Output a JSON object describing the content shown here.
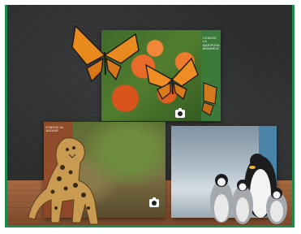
{
  "cards": {
    "top": {
      "side_text": "CONOCE LA\nMARIPOSA MONARCA"
    },
    "left": {
      "side_text": "CONOCE AL\nJAGUAR"
    },
    "right": {
      "side_text": ""
    }
  },
  "icons": {
    "camera": "camera-icon",
    "butterfly": "butterfly",
    "jaguar": "jaguar",
    "penguin": "penguin"
  },
  "colors": {
    "frame_border": "#1f8a4c",
    "background": "#2a2b2c",
    "floor": "#a66a43"
  }
}
